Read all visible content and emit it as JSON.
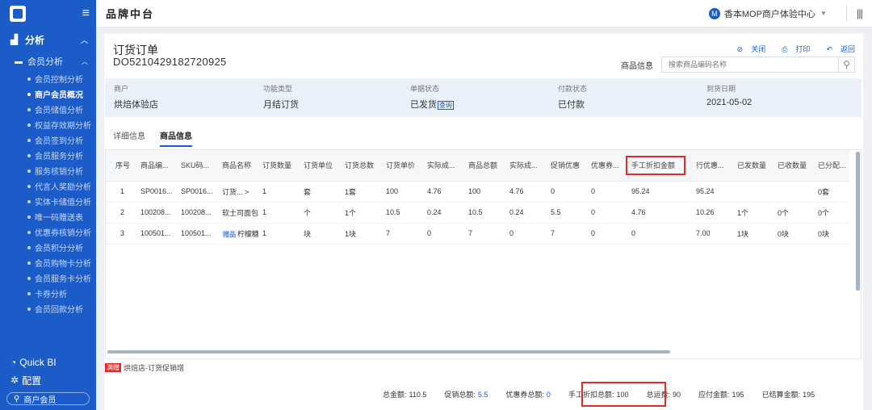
{
  "sidebar": {
    "section": "分析",
    "group": "会员分析",
    "items": [
      "会员控制分析",
      "商户会员概况",
      "会员储值分析",
      "权益存效期分析",
      "会员签到分析",
      "会员服务分析",
      "服务核销分析",
      "代言人奖励分析",
      "实体卡储值分析",
      "唯一码赠送表",
      "优惠券核销分析",
      "会员积分分析",
      "会员购物卡分析",
      "会员服务卡分析",
      "卡券分析",
      "会员回款分析"
    ],
    "active_index": 1,
    "quickbi": "Quick BI",
    "config": "配置",
    "search": "商户会员"
  },
  "topbar": {
    "brand": "品牌中台",
    "account": "香本MOP商户体验中心",
    "avatar": "M"
  },
  "order": {
    "title": "订货订单",
    "number": "DO5210429182720925",
    "actions": {
      "close": "关闭",
      "print": "打印",
      "back": "返回"
    },
    "search_label": "商品信息",
    "search_placeholder": "搜索商品编码名称"
  },
  "info": [
    {
      "k": "商户",
      "v": "烘焙体验店"
    },
    {
      "k": "功能类型",
      "v": "月结订货"
    },
    {
      "k": "单据状态",
      "v": "已发货",
      "tag": "查询"
    },
    {
      "k": "付款状态",
      "v": "已付款"
    },
    {
      "k": "到货日期",
      "v": "2021-05-02"
    }
  ],
  "tabs": [
    "详细信息",
    "商品信息"
  ],
  "active_tab": 1,
  "table": {
    "headers": [
      "序号",
      "商品编...",
      "SKU码...",
      "商品名称",
      "订货数量",
      "订货单位",
      "订货总数",
      "订货单价",
      "实际成...",
      "商品总额",
      "实际成...",
      "促销优惠",
      "优惠券...",
      "手工折扣金额",
      "行优惠...",
      "已发数量",
      "已收数量",
      "已分配..."
    ],
    "rows": [
      [
        "1",
        "SP0016...",
        "SP0016...",
        "订货... >",
        "1",
        "套",
        "1套",
        "100",
        "4.76",
        "100",
        "4.76",
        "0",
        "0",
        "95.24",
        "95.24",
        "",
        "",
        "0套"
      ],
      [
        "2",
        "100208...",
        "100208...",
        "软土司面包",
        "1",
        "个",
        "1个",
        "10.5",
        "0.24",
        "10.5",
        "0.24",
        "5.5",
        "0",
        "4.76",
        "10.26",
        "1个",
        "0个",
        "0个"
      ],
      [
        "3",
        "100501...",
        "100501...",
        "柠檬糖",
        "1",
        "块",
        "1块",
        "7",
        "0",
        "7",
        "0",
        "7",
        "0",
        "0",
        "7.00",
        "1块",
        "0块",
        "0块"
      ]
    ],
    "gift_tag": "赠品"
  },
  "promo": {
    "tag": "满赠",
    "text": "烘焙店-订货促销增"
  },
  "summary": [
    {
      "k": "总金额:",
      "v": "110.5"
    },
    {
      "k": "促销总额:",
      "v": "5.5",
      "blue": true
    },
    {
      "k": "优惠券总额:",
      "v": "0",
      "blue": true
    },
    {
      "k": "手工折扣总额:",
      "v": "100"
    },
    {
      "k": "总运费:",
      "v": "90"
    },
    {
      "k": "应付金额:",
      "v": "195"
    },
    {
      "k": "已结算金额:",
      "v": "195"
    }
  ]
}
